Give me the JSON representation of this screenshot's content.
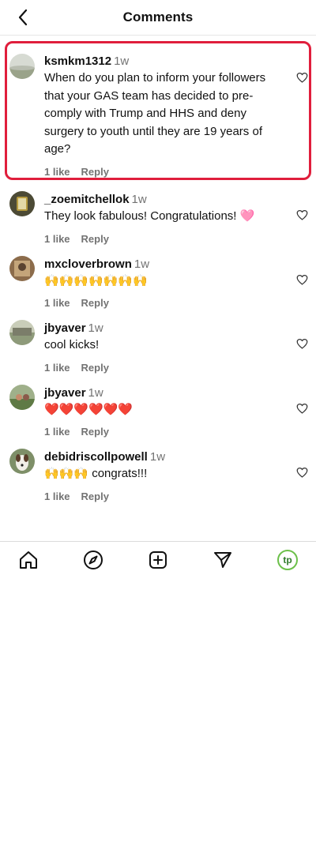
{
  "header": {
    "title": "Comments",
    "back_icon": "chevron-left-icon"
  },
  "comments": [
    {
      "user": "ksmkm1312",
      "time": "1w",
      "text": "When do you plan to inform your followers that your GAS team has decided to pre-comply with Trump and HHS and deny surgery to youth until they are 19 years of age?",
      "likes": "1 like",
      "reply": "Reply",
      "avatar_color": "#c9cfc3"
    },
    {
      "user": "_zoemitchellok",
      "time": "1w",
      "text": "They look fabulous! Congratulations! 🩷",
      "likes": "1 like",
      "reply": "Reply",
      "avatar_color": "#5a5540"
    },
    {
      "user": "mxcloverbrown",
      "time": "1w",
      "text": "🙌🙌🙌🙌🙌🙌🙌",
      "likes": "1 like",
      "reply": "Reply",
      "avatar_color": "#8a6e4e"
    },
    {
      "user": "jbyaver",
      "time": "1w",
      "text": "cool kicks!",
      "likes": "1 like",
      "reply": "Reply",
      "avatar_color": "#8e9a7a"
    },
    {
      "user": "jbyaver",
      "time": "1w",
      "text": "❤️❤️❤️❤️❤️❤️",
      "likes": "1 like",
      "reply": "Reply",
      "avatar_color": "#6f8a5a"
    },
    {
      "user": "debidriscollpowell",
      "time": "1w",
      "text": "🙌🙌🙌 congrats!!!",
      "likes": "1 like",
      "reply": "Reply",
      "avatar_color": "#7a8a6a"
    }
  ],
  "tabbar": {
    "items": [
      "home-icon",
      "explore-icon",
      "create-icon",
      "direct-message-icon",
      "profile-avatar"
    ],
    "profile_initials": "tp"
  },
  "colors": {
    "highlight": "#e01e3c",
    "secondary_text": "#737373",
    "profile_ring": "#6cc04a"
  }
}
